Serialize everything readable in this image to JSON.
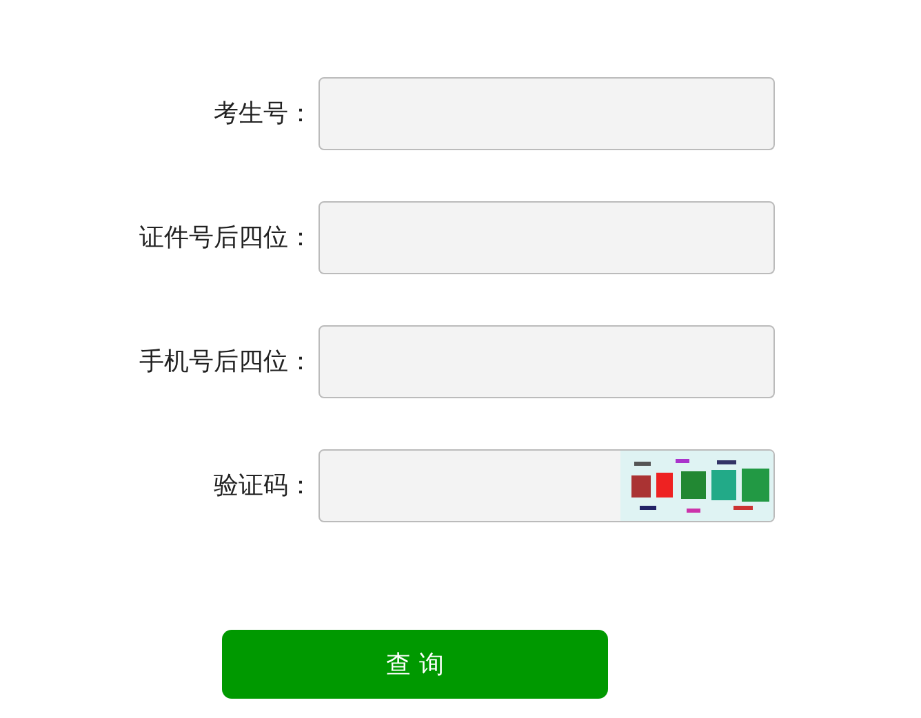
{
  "fields": [
    {
      "label": "考生号：",
      "kind": "text"
    },
    {
      "label": "证件号后四位：",
      "kind": "text"
    },
    {
      "label": "手机号后四位：",
      "kind": "text"
    },
    {
      "label": "验证码：",
      "kind": "captcha"
    }
  ],
  "submit_button": "查 询"
}
